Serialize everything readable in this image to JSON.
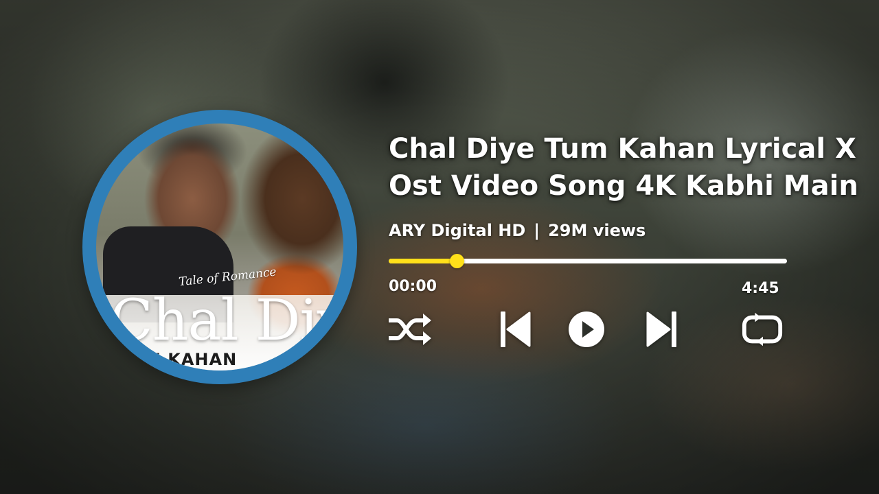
{
  "album_art": {
    "tagline": "Tale of Romance",
    "title": "Chal Diye",
    "subtitle": "M KAHAN",
    "ring_color": "#2f7fb8"
  },
  "track": {
    "title": "Chal Diye Tum Kahan Lyrical X Ost Video Song 4K Kabhi Main",
    "channel": "ARY Digital HD",
    "separator": "|",
    "views": "29M views"
  },
  "progress": {
    "current_time": "00:00",
    "total_time": "4:45",
    "fraction": 0.17,
    "fill_color": "#ffe01a",
    "track_color": "#ffffff"
  },
  "controls": [
    {
      "name": "shuffle",
      "icon": "shuffle-icon"
    },
    {
      "name": "previous",
      "icon": "skip-previous-icon"
    },
    {
      "name": "play",
      "icon": "play-icon"
    },
    {
      "name": "next",
      "icon": "skip-next-icon"
    },
    {
      "name": "repeat",
      "icon": "repeat-icon"
    }
  ]
}
